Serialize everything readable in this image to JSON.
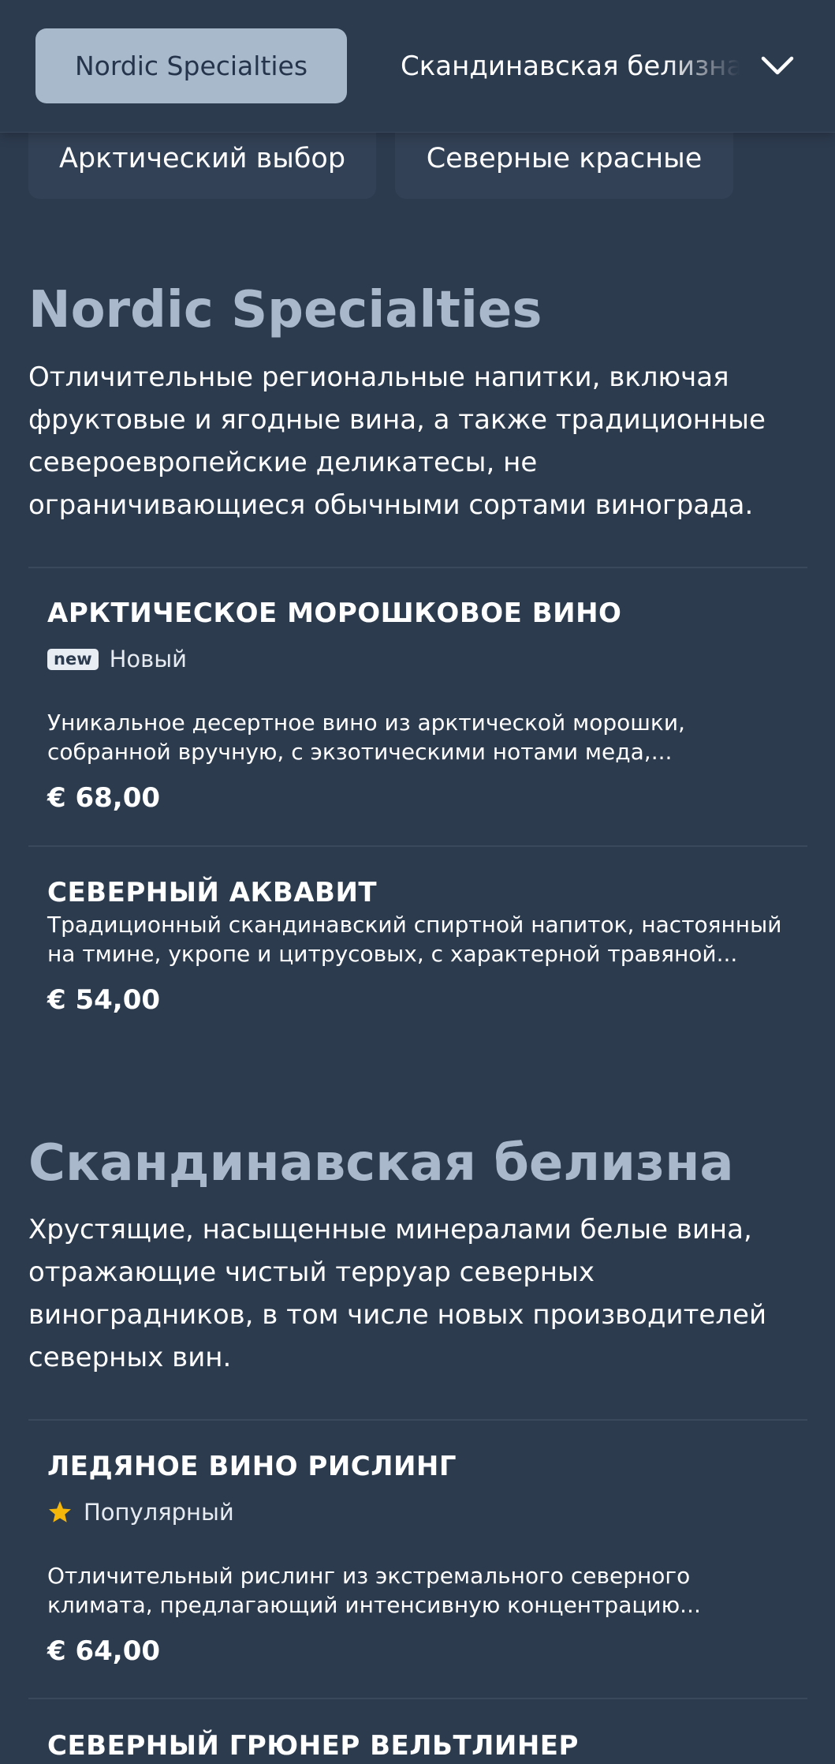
{
  "nav": {
    "active_tab": "Nordic Specialties",
    "next_tab": "Скандинавская белизна",
    "subcategories": [
      "Арктический выбор",
      "Северные красные"
    ]
  },
  "sections": [
    {
      "title": "Nordic Specialties",
      "description": "Отличительные региональные напитки, включая фруктовые и ягодные вина, а также традиционные североевропейские деликатесы, не ограничивающиеся обычными сортами винограда.",
      "products": [
        {
          "name": "АРКТИЧЕСКОЕ МОРОШКОВОЕ ВИНО",
          "badge_tag": "new",
          "badge_label": "Новый",
          "description_line1": "Уникальное десертное вино из арктической морошки,",
          "description_line2": "собранной вручную, с экзотическими нотами меда,...",
          "price": "€ 68,00"
        },
        {
          "name": "СЕВЕРНЫЙ АКВАВИТ",
          "description_line1": "Традиционный скандинавский спиртной напиток, настоянный",
          "description_line2": "на тмине, укропе и цитрусовых, с характерной травяной...",
          "price": "€ 54,00"
        }
      ]
    },
    {
      "title": "Скандинавская белизна",
      "description": "Хрустящие, насыщенные минералами белые вина, отражающие чистый терруар северных виноградников, в том числе новых производителей северных вин.",
      "products": [
        {
          "name": "ЛЕДЯНОЕ ВИНО РИСЛИНГ",
          "badge_icon": "star-icon",
          "badge_label": "Популярный",
          "description_line1": "Отличительный рислинг из экстремального северного",
          "description_line2": "климата, предлагающий интенсивную концентрацию...",
          "price": "€ 64,00"
        },
        {
          "name": "СЕВЕРНЫЙ ГРЮНЕР ВЕЛЬТЛИНЕР"
        }
      ]
    }
  ],
  "colors": {
    "background": "#2d3b4f",
    "accent": "#a9b9cc",
    "star": "#f5b80a"
  }
}
